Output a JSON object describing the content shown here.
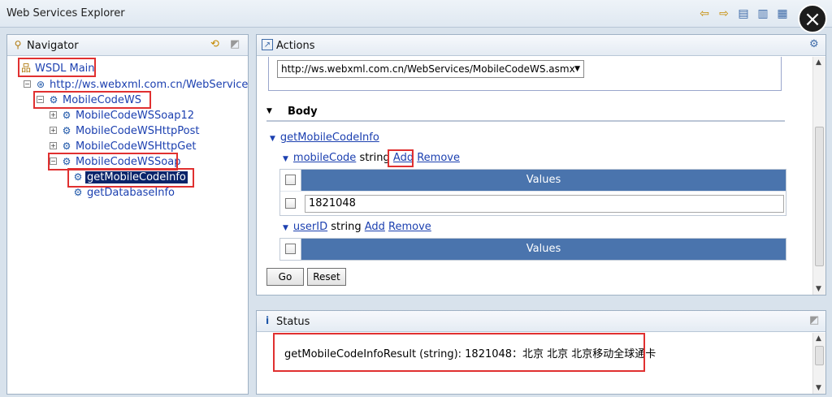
{
  "window": {
    "title": "Web Services Explorer"
  },
  "toolbar": {
    "icons": [
      "back-arrow-icon",
      "forward-arrow-icon",
      "favorites-icon",
      "wsil-icon",
      "wsdl-icon"
    ]
  },
  "navigator": {
    "title": "Navigator",
    "tree": {
      "root": "WSDL Main",
      "wsdl_url": "http://ws.webxml.com.cn/WebServices/Mo",
      "service": "MobileCodeWS",
      "bindings": [
        "MobileCodeWSSoap12",
        "MobileCodeWSHttpPost",
        "MobileCodeWSHttpGet",
        "MobileCodeWSSoap"
      ],
      "operations": [
        "getMobileCodeInfo",
        "getDatabaseInfo"
      ]
    }
  },
  "actions": {
    "title": "Actions",
    "endpoint": "http://ws.webxml.com.cn/WebServices/MobileCodeWS.asmx",
    "body_label": "Body",
    "operation": "getMobileCodeInfo",
    "params": [
      {
        "name": "mobileCode",
        "type": "string",
        "add": "Add",
        "remove": "Remove",
        "values_header": "Values",
        "value": "1821048"
      },
      {
        "name": "userID",
        "type": "string",
        "add": "Add",
        "remove": "Remove",
        "values_header": "Values"
      }
    ],
    "go_label": "Go",
    "reset_label": "Reset"
  },
  "status": {
    "title": "Status",
    "result": "getMobileCodeInfoResult (string): 1821048：北京 北京 北京移动全球通卡"
  },
  "colors": {
    "accent": "#4a74ad",
    "highlight": "#e03030",
    "link": "#1c40b0"
  }
}
